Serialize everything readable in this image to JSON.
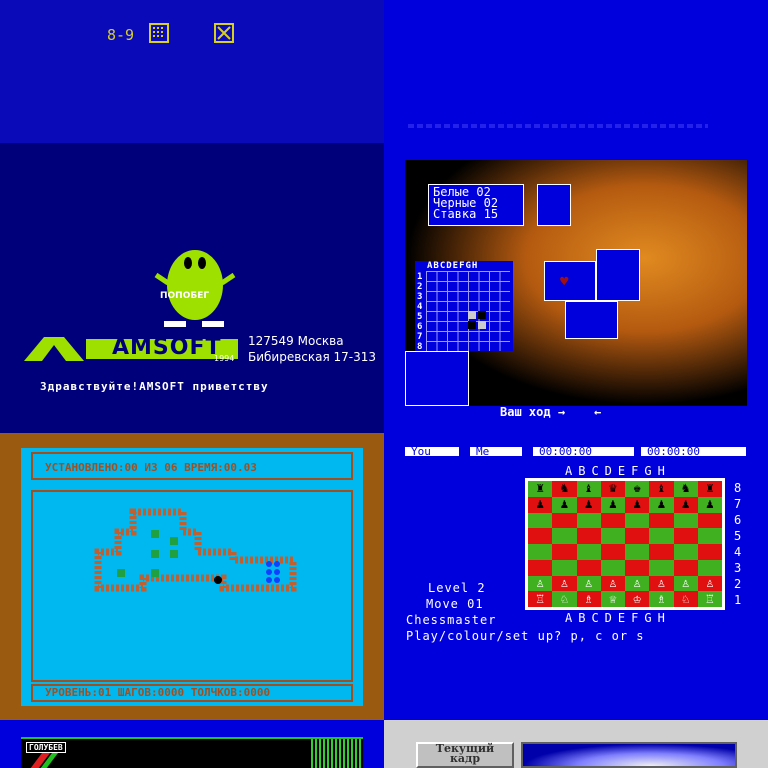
{
  "panel1": {
    "label": "8-9",
    "icons": [
      "grid-box-icon",
      "crossed-box-icon"
    ],
    "colors": {
      "bg": "#0a0ab8",
      "fg": "#d8d020"
    }
  },
  "panel2": {
    "colors": {
      "bg": "#0000dd"
    }
  },
  "panel3": {
    "mascot_label": "ПОПОБЕГ",
    "logo": "AMSOFT",
    "year": "1994",
    "address_line1": "127549 Москва",
    "address_line2": "Бибиревская 17-313",
    "greeting": "Здравствуйте!AMSOFT приветству",
    "colors": {
      "bg": "#00007a",
      "accent": "#b8f000"
    }
  },
  "panel4": {
    "score": {
      "white_label": "Белые",
      "white_value": "02",
      "black_label": "Черные",
      "black_value": "02",
      "stake_label": "Ставка",
      "stake_value": "15"
    },
    "board_header": "ABCDEFGH",
    "board_rows": [
      "1",
      "2",
      "3",
      "4",
      "5",
      "6",
      "7",
      "8"
    ],
    "turn_prompt": "Ваш ход",
    "turn_arrow_right": "→",
    "turn_arrow_left": "←",
    "heart": "♥"
  },
  "panel5": {
    "status_top": "УСТАНОВЛЕНО:00 ИЗ 06    ВРЕМЯ:00.03",
    "status_bottom": "УРОВЕНЬ:01   ШАГОВ:0000  ТОЛЧКОВ:0000",
    "colors": {
      "bg": "#9a5a10",
      "screen": "#00b8f0",
      "wall": "#a05020"
    }
  },
  "panel6": {
    "header": {
      "you": "You",
      "me": "Me",
      "time_you": "00:00:00",
      "time_me": "00:00:00"
    },
    "files": "ABCDEFGH",
    "ranks": [
      "8",
      "7",
      "6",
      "5",
      "4",
      "3",
      "2",
      "1"
    ],
    "board": [
      [
        "♜",
        "♞",
        "♝",
        "♛",
        "♚",
        "♝",
        "♞",
        "♜"
      ],
      [
        "♟",
        "♟",
        "♟",
        "♟",
        "♟",
        "♟",
        "♟",
        "♟"
      ],
      [
        "",
        "",
        "",
        "",
        "",
        "",
        "",
        ""
      ],
      [
        "",
        "",
        "",
        "",
        "",
        "",
        "",
        ""
      ],
      [
        "",
        "",
        "",
        "",
        "",
        "",
        "",
        ""
      ],
      [
        "",
        "",
        "",
        "",
        "",
        "",
        "",
        ""
      ],
      [
        "♙",
        "♙",
        "♙",
        "♙",
        "♙",
        "♙",
        "♙",
        "♙"
      ],
      [
        "♖",
        "♘",
        "♗",
        "♕",
        "♔",
        "♗",
        "♘",
        "♖"
      ]
    ],
    "level_line": "Level  2",
    "move_line": "Move 01",
    "title_line": "Chessmaster",
    "prompt_line": "Play/colour/set up? p, c or s",
    "colors": {
      "light": "#40b020",
      "dark": "#e01010"
    }
  },
  "panel7": {
    "tag": "ГОЛУБЕВ"
  },
  "panel8": {
    "button_label_line1": "Текущий",
    "button_label_line2": "кадр"
  }
}
